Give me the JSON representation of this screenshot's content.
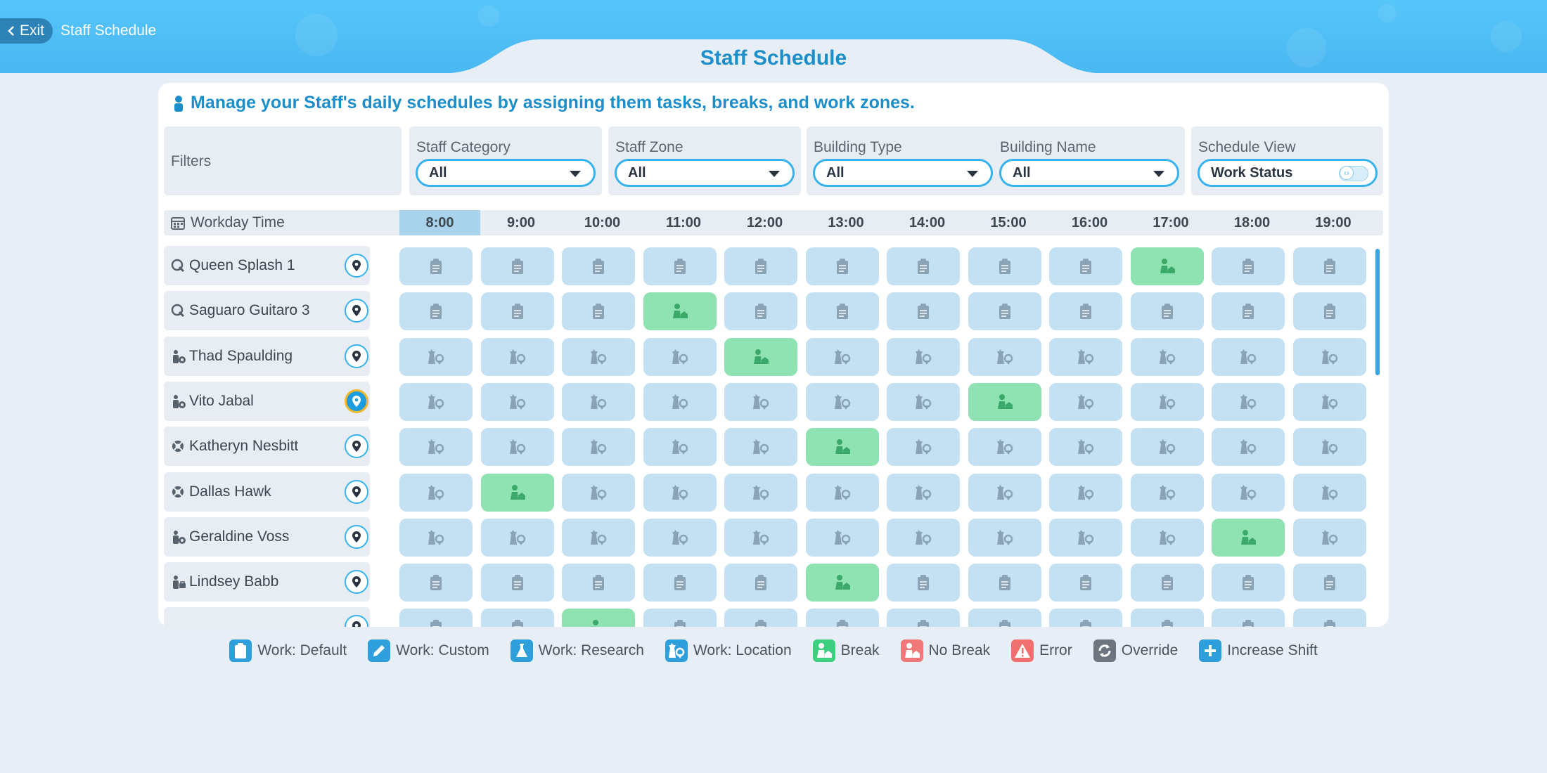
{
  "header": {
    "exit_label": "Exit",
    "breadcrumb": "Staff Schedule",
    "title": "Staff Schedule"
  },
  "intro": "Manage your Staff's daily schedules by assigning them tasks, breaks, and work zones.",
  "filters": {
    "label": "Filters",
    "staff_category": {
      "label": "Staff Category",
      "value": "All"
    },
    "staff_zone": {
      "label": "Staff Zone",
      "value": "All"
    },
    "building_type": {
      "label": "Building Type",
      "value": "All"
    },
    "building_name": {
      "label": "Building Name",
      "value": "All"
    },
    "schedule_view": {
      "label": "Schedule View",
      "value": "Work Status"
    }
  },
  "timeline": {
    "label": "Workday Time",
    "hours": [
      "8:00",
      "9:00",
      "10:00",
      "11:00",
      "12:00",
      "13:00",
      "14:00",
      "15:00",
      "16:00",
      "17:00",
      "18:00",
      "19:00"
    ],
    "active_hour": 0
  },
  "staff": [
    {
      "name": "Queen Splash 1",
      "icon": "mascot-icon",
      "task": "default",
      "break_hour": 9
    },
    {
      "name": "Saguaro Guitaro 3",
      "icon": "mascot-icon",
      "task": "default",
      "break_hour": 3
    },
    {
      "name": "Thad Spaulding",
      "icon": "janitor-icon",
      "task": "location",
      "break_hour": 4
    },
    {
      "name": "Vito Jabal",
      "icon": "janitor-icon",
      "task": "location",
      "break_hour": 7,
      "selected": true
    },
    {
      "name": "Katheryn Nesbitt",
      "icon": "lifeguard-icon",
      "task": "location",
      "break_hour": 5
    },
    {
      "name": "Dallas Hawk",
      "icon": "lifeguard-icon",
      "task": "location",
      "break_hour": 1
    },
    {
      "name": "Geraldine Voss",
      "icon": "janitor-icon",
      "task": "location",
      "break_hour": 10
    },
    {
      "name": "Lindsey Babb",
      "icon": "mechanic-icon",
      "task": "default",
      "break_hour": 5
    },
    {
      "name": "",
      "icon": "",
      "task": "default",
      "break_hour": 2
    }
  ],
  "legend": [
    {
      "label": "Work: Default",
      "color": "#2f9fdc",
      "icon": "clipboard-icon"
    },
    {
      "label": "Work: Custom",
      "color": "#2f9fdc",
      "icon": "pencil-icon"
    },
    {
      "label": "Work: Research",
      "color": "#2f9fdc",
      "icon": "flask-icon"
    },
    {
      "label": "Work: Location",
      "color": "#2f9fdc",
      "icon": "tower-pin-icon"
    },
    {
      "label": "Break",
      "color": "#3fcf80",
      "icon": "break-icon"
    },
    {
      "label": "No Break",
      "color": "#f07878",
      "icon": "no-break-icon"
    },
    {
      "label": "Error",
      "color": "#f07070",
      "icon": "warning-icon"
    },
    {
      "label": "Override",
      "color": "#6d767f",
      "icon": "override-icon"
    },
    {
      "label": "Increase Shift",
      "color": "#2f9fdc",
      "icon": "plus-icon"
    }
  ]
}
